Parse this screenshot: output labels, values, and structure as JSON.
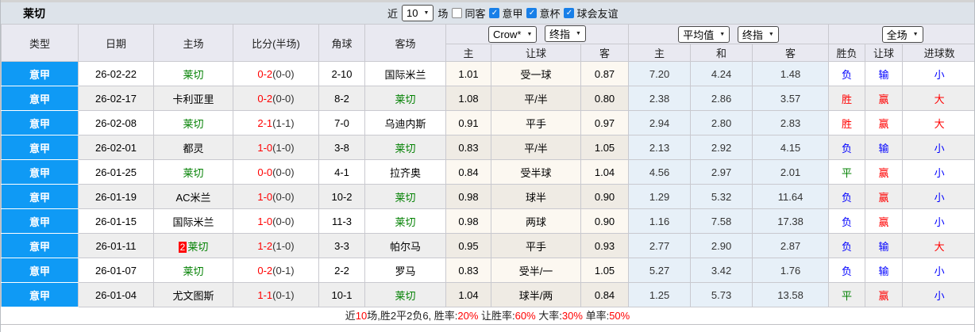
{
  "title": "莱切",
  "colors": {
    "league_bg": "#0f9af5",
    "win_red": "#ff0000",
    "lose_blue": "#0000ff",
    "draw_green": "#008000",
    "team_green": "#008000",
    "europe_cell_bg": "#e7f0f8",
    "asia_cell_bg": "#fcf8f1"
  },
  "topbar": {
    "recent_label": "近",
    "recent_value": "10",
    "unit_label": "场",
    "filters": [
      {
        "label": "同客",
        "checked": false
      },
      {
        "label": "意甲",
        "checked": true
      },
      {
        "label": "意杯",
        "checked": true
      },
      {
        "label": "球会友谊",
        "checked": true
      }
    ]
  },
  "table": {
    "static_headers": [
      "类型",
      "日期",
      "主场",
      "比分(半场)",
      "角球",
      "客场"
    ],
    "asia_group": {
      "selects": [
        "Crow*",
        "终指"
      ],
      "sub": [
        "主",
        "让球",
        "客"
      ]
    },
    "europe_group": {
      "selects": [
        "平均值",
        "终指"
      ],
      "sub": [
        "主",
        "和",
        "客"
      ]
    },
    "result_group": {
      "select": "全场",
      "sub": [
        "胜负",
        "让球",
        "进球数"
      ]
    },
    "rows": [
      {
        "league": "意甲",
        "date": "26-02-22",
        "home": {
          "name": "莱切",
          "green": true,
          "badge": ""
        },
        "score": "0-2",
        "half": "(0-0)",
        "corner": "2-10",
        "away": {
          "name": "国际米兰",
          "green": false,
          "badge": ""
        },
        "asia": [
          "1.01",
          "受一球",
          "0.87"
        ],
        "europe": [
          "7.20",
          "4.24",
          "1.48"
        ],
        "results": [
          {
            "t": "负",
            "c": "blue"
          },
          {
            "t": "输",
            "c": "blue"
          },
          {
            "t": "小",
            "c": "blue"
          }
        ]
      },
      {
        "league": "意甲",
        "date": "26-02-17",
        "home": {
          "name": "卡利亚里",
          "green": false,
          "badge": ""
        },
        "score": "0-2",
        "half": "(0-0)",
        "corner": "8-2",
        "away": {
          "name": "莱切",
          "green": true,
          "badge": ""
        },
        "asia": [
          "1.08",
          "平/半",
          "0.80"
        ],
        "europe": [
          "2.38",
          "2.86",
          "3.57"
        ],
        "results": [
          {
            "t": "胜",
            "c": "red"
          },
          {
            "t": "赢",
            "c": "red"
          },
          {
            "t": "大",
            "c": "red"
          }
        ]
      },
      {
        "league": "意甲",
        "date": "26-02-08",
        "home": {
          "name": "莱切",
          "green": true,
          "badge": ""
        },
        "score": "2-1",
        "half": "(1-1)",
        "corner": "7-0",
        "away": {
          "name": "乌迪内斯",
          "green": false,
          "badge": ""
        },
        "asia": [
          "0.91",
          "平手",
          "0.97"
        ],
        "europe": [
          "2.94",
          "2.80",
          "2.83"
        ],
        "results": [
          {
            "t": "胜",
            "c": "red"
          },
          {
            "t": "赢",
            "c": "red"
          },
          {
            "t": "大",
            "c": "red"
          }
        ]
      },
      {
        "league": "意甲",
        "date": "26-02-01",
        "home": {
          "name": "都灵",
          "green": false,
          "badge": ""
        },
        "score": "1-0",
        "half": "(1-0)",
        "corner": "3-8",
        "away": {
          "name": "莱切",
          "green": true,
          "badge": ""
        },
        "asia": [
          "0.83",
          "平/半",
          "1.05"
        ],
        "europe": [
          "2.13",
          "2.92",
          "4.15"
        ],
        "results": [
          {
            "t": "负",
            "c": "blue"
          },
          {
            "t": "输",
            "c": "blue"
          },
          {
            "t": "小",
            "c": "blue"
          }
        ]
      },
      {
        "league": "意甲",
        "date": "26-01-25",
        "home": {
          "name": "莱切",
          "green": true,
          "badge": ""
        },
        "score": "0-0",
        "half": "(0-0)",
        "corner": "4-1",
        "away": {
          "name": "拉齐奥",
          "green": false,
          "badge": ""
        },
        "asia": [
          "0.84",
          "受半球",
          "1.04"
        ],
        "europe": [
          "4.56",
          "2.97",
          "2.01"
        ],
        "results": [
          {
            "t": "平",
            "c": "green"
          },
          {
            "t": "赢",
            "c": "red"
          },
          {
            "t": "小",
            "c": "blue"
          }
        ]
      },
      {
        "league": "意甲",
        "date": "26-01-19",
        "home": {
          "name": "AC米兰",
          "green": false,
          "badge": ""
        },
        "score": "1-0",
        "half": "(0-0)",
        "corner": "10-2",
        "away": {
          "name": "莱切",
          "green": true,
          "badge": ""
        },
        "asia": [
          "0.98",
          "球半",
          "0.90"
        ],
        "europe": [
          "1.29",
          "5.32",
          "11.64"
        ],
        "results": [
          {
            "t": "负",
            "c": "blue"
          },
          {
            "t": "赢",
            "c": "red"
          },
          {
            "t": "小",
            "c": "blue"
          }
        ]
      },
      {
        "league": "意甲",
        "date": "26-01-15",
        "home": {
          "name": "国际米兰",
          "green": false,
          "badge": ""
        },
        "score": "1-0",
        "half": "(0-0)",
        "corner": "11-3",
        "away": {
          "name": "莱切",
          "green": true,
          "badge": ""
        },
        "asia": [
          "0.98",
          "两球",
          "0.90"
        ],
        "europe": [
          "1.16",
          "7.58",
          "17.38"
        ],
        "results": [
          {
            "t": "负",
            "c": "blue"
          },
          {
            "t": "赢",
            "c": "red"
          },
          {
            "t": "小",
            "c": "blue"
          }
        ]
      },
      {
        "league": "意甲",
        "date": "26-01-11",
        "home": {
          "name": "莱切",
          "green": true,
          "badge": "2"
        },
        "score": "1-2",
        "half": "(1-0)",
        "corner": "3-3",
        "away": {
          "name": "帕尔马",
          "green": false,
          "badge": ""
        },
        "asia": [
          "0.95",
          "平手",
          "0.93"
        ],
        "europe": [
          "2.77",
          "2.90",
          "2.87"
        ],
        "results": [
          {
            "t": "负",
            "c": "blue"
          },
          {
            "t": "输",
            "c": "blue"
          },
          {
            "t": "大",
            "c": "red"
          }
        ]
      },
      {
        "league": "意甲",
        "date": "26-01-07",
        "home": {
          "name": "莱切",
          "green": true,
          "badge": ""
        },
        "score": "0-2",
        "half": "(0-1)",
        "corner": "2-2",
        "away": {
          "name": "罗马",
          "green": false,
          "badge": ""
        },
        "asia": [
          "0.83",
          "受半/一",
          "1.05"
        ],
        "europe": [
          "5.27",
          "3.42",
          "1.76"
        ],
        "results": [
          {
            "t": "负",
            "c": "blue"
          },
          {
            "t": "输",
            "c": "blue"
          },
          {
            "t": "小",
            "c": "blue"
          }
        ]
      },
      {
        "league": "意甲",
        "date": "26-01-04",
        "home": {
          "name": "尤文图斯",
          "green": false,
          "badge": ""
        },
        "score": "1-1",
        "half": "(0-1)",
        "corner": "10-1",
        "away": {
          "name": "莱切",
          "green": true,
          "badge": ""
        },
        "asia": [
          "1.04",
          "球半/两",
          "0.84"
        ],
        "europe": [
          "1.25",
          "5.73",
          "13.58"
        ],
        "results": [
          {
            "t": "平",
            "c": "green"
          },
          {
            "t": "赢",
            "c": "red"
          },
          {
            "t": "小",
            "c": "blue"
          }
        ]
      }
    ]
  },
  "summary": {
    "segments": [
      {
        "text": "近",
        "red": false
      },
      {
        "text": "10",
        "red": true
      },
      {
        "text": "场,胜2平2负6, 胜率:",
        "red": false
      },
      {
        "text": "20%",
        "red": true
      },
      {
        "text": " 让胜率:",
        "red": false
      },
      {
        "text": "60%",
        "red": true
      },
      {
        "text": " 大率:",
        "red": false
      },
      {
        "text": "30%",
        "red": true
      },
      {
        "text": " 单率:",
        "red": false
      },
      {
        "text": "50%",
        "red": true
      }
    ]
  }
}
